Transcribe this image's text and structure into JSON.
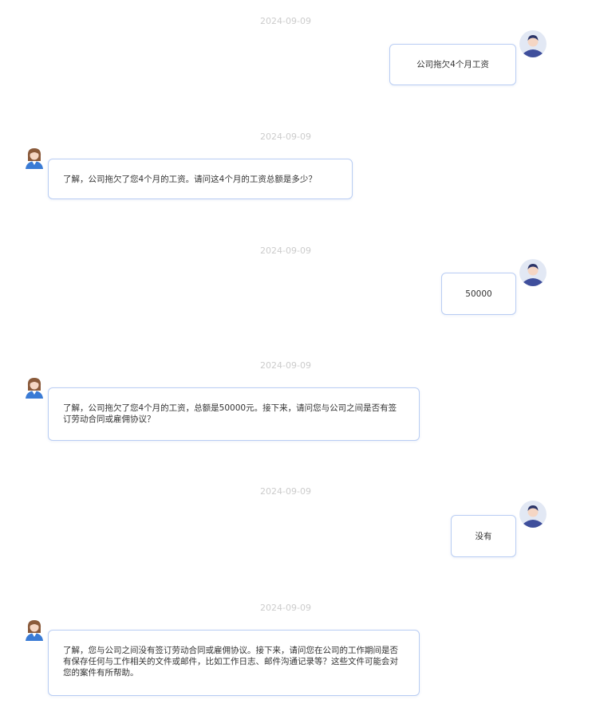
{
  "messages": [
    {
      "date": "2024-09-09",
      "sender": "user",
      "text": "公司拖欠4个月工资",
      "avatar_icon": "user-avatar-icon"
    },
    {
      "date": "2024-09-09",
      "sender": "bot",
      "text": "了解，公司拖欠了您4个月的工资。请问这4个月的工资总额是多少？",
      "avatar_icon": "assistant-avatar-icon"
    },
    {
      "date": "2024-09-09",
      "sender": "user",
      "text": "50000",
      "avatar_icon": "user-avatar-icon"
    },
    {
      "date": "2024-09-09",
      "sender": "bot",
      "text": "了解，公司拖欠了您4个月的工资，总额是50000元。接下来，请问您与公司之间是否有签订劳动合同或雇佣协议？",
      "avatar_icon": "assistant-avatar-icon"
    },
    {
      "date": "2024-09-09",
      "sender": "user",
      "text": "没有",
      "avatar_icon": "user-avatar-icon"
    },
    {
      "date": "2024-09-09",
      "sender": "bot",
      "text": "了解，您与公司之间没有签订劳动合同或雇佣协议。接下来，请问您在公司的工作期间是否有保存任何与工作相关的文件或邮件，比如工作日志、邮件沟通记录等？这些文件可能会对您的案件有所帮助。",
      "avatar_icon": "assistant-avatar-icon"
    }
  ],
  "colors": {
    "bubble_border": "#b9cdf3",
    "date_text": "#cccccc",
    "user_avatar_bg": "#e2e8f4",
    "user_avatar_figure": "#3f4f9c"
  }
}
